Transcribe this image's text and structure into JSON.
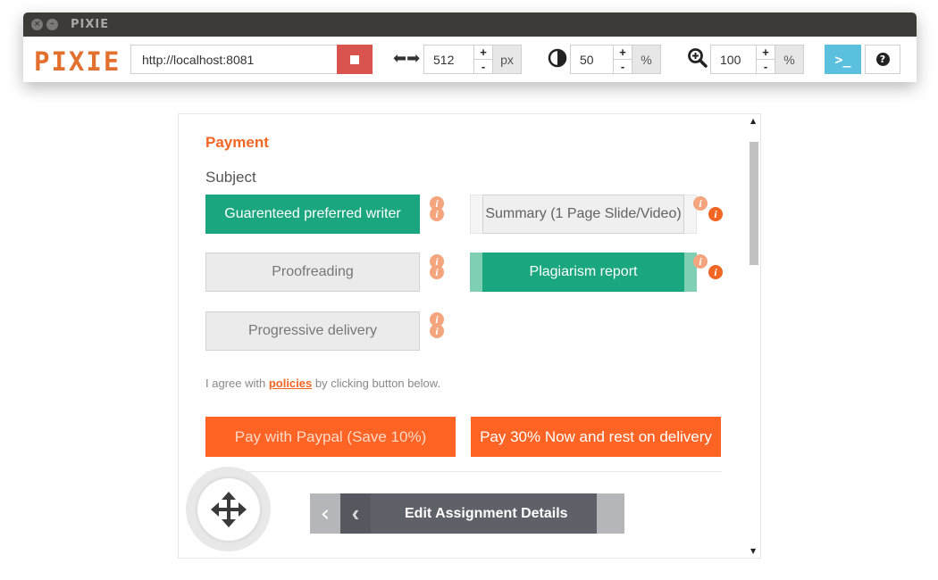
{
  "window": {
    "title": "PIXIE"
  },
  "toolbar": {
    "logo": "PIXIE",
    "url": "http://localhost:8081",
    "width": {
      "value": "512",
      "unit": "px",
      "plus": "+",
      "minus": "-"
    },
    "opacity": {
      "value": "50",
      "unit": "%",
      "plus": "+",
      "minus": "-"
    },
    "zoom": {
      "value": "100",
      "unit": "%",
      "plus": "+",
      "minus": "-"
    },
    "console_label": ">_",
    "help_label": "?"
  },
  "page": {
    "heading": "Payment",
    "subject_label": "Subject",
    "options": {
      "guaranteed": "Guarenteed preferred writer",
      "summary": "Summary (1 Page Slide/Video)",
      "proofreading": "Proofreading",
      "plagiarism": "Plagiarism report",
      "progressive": "Progressive delivery"
    },
    "info_glyph": "i",
    "agree": {
      "before": "I agree with ",
      "link": "policies",
      "after": " by clicking button below."
    },
    "pay_paypal": "Pay with Paypal (Save 10%)",
    "pay_30": "Pay 30% Now and rest on delivery",
    "edit_details": "Edit Assignment Details"
  },
  "colors": {
    "accent_orange": "#f26522",
    "active_green": "#1aa67e",
    "pay_orange": "#ff6424",
    "console_blue": "#5bc0de",
    "stop_red": "#d9534f"
  }
}
